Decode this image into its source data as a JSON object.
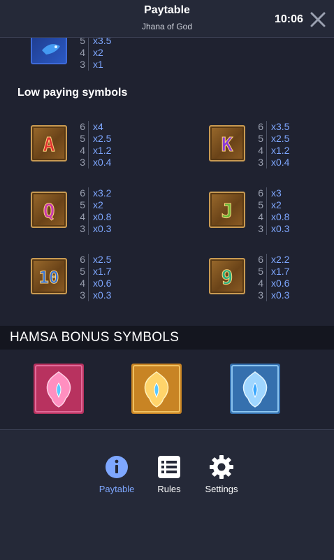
{
  "header": {
    "title": "Paytable",
    "subtitle": "Jhana of God",
    "time": "10:06"
  },
  "top_partial": {
    "rows": [
      {
        "count": "5",
        "mult": "x3.5"
      },
      {
        "count": "4",
        "mult": "x2"
      },
      {
        "count": "3",
        "mult": "x1"
      }
    ]
  },
  "low_title": "Low paying symbols",
  "low_symbols": [
    {
      "letter": "A",
      "color": "#c0282a",
      "pays": [
        {
          "count": "6",
          "mult": "x4"
        },
        {
          "count": "5",
          "mult": "x2.5"
        },
        {
          "count": "4",
          "mult": "x1.2"
        },
        {
          "count": "3",
          "mult": "x0.4"
        }
      ]
    },
    {
      "letter": "K",
      "color": "#7a3cc8",
      "pays": [
        {
          "count": "6",
          "mult": "x3.5"
        },
        {
          "count": "5",
          "mult": "x2.5"
        },
        {
          "count": "4",
          "mult": "x1.2"
        },
        {
          "count": "3",
          "mult": "x0.4"
        }
      ]
    },
    {
      "letter": "Q",
      "color": "#c23aa8",
      "pays": [
        {
          "count": "6",
          "mult": "x3.2"
        },
        {
          "count": "5",
          "mult": "x2"
        },
        {
          "count": "4",
          "mult": "x0.8"
        },
        {
          "count": "3",
          "mult": "x0.3"
        }
      ]
    },
    {
      "letter": "J",
      "color": "#5ea83a",
      "pays": [
        {
          "count": "6",
          "mult": "x3"
        },
        {
          "count": "5",
          "mult": "x2"
        },
        {
          "count": "4",
          "mult": "x0.8"
        },
        {
          "count": "3",
          "mult": "x0.3"
        }
      ]
    },
    {
      "letter": "10",
      "color": "#2f64c8",
      "pays": [
        {
          "count": "6",
          "mult": "x2.5"
        },
        {
          "count": "5",
          "mult": "x1.7"
        },
        {
          "count": "4",
          "mult": "x0.6"
        },
        {
          "count": "3",
          "mult": "x0.3"
        }
      ]
    },
    {
      "letter": "9",
      "color": "#2aa07a",
      "pays": [
        {
          "count": "6",
          "mult": "x2.2"
        },
        {
          "count": "5",
          "mult": "x1.7"
        },
        {
          "count": "4",
          "mult": "x0.6"
        },
        {
          "count": "3",
          "mult": "x0.3"
        }
      ]
    }
  ],
  "bonus_title": "HAMSA BONUS SYMBOLS",
  "hamsa": [
    {
      "name": "pink",
      "bg": "#c03a6a",
      "accent": "#ff8fc0"
    },
    {
      "name": "gold",
      "bg": "#d0902a",
      "accent": "#ffd46a"
    },
    {
      "name": "blue",
      "bg": "#3a78b8",
      "accent": "#9fd6ff"
    }
  ],
  "nav": {
    "paytable": "Paytable",
    "rules": "Rules",
    "settings": "Settings",
    "active_color": "#7ea7ff"
  }
}
